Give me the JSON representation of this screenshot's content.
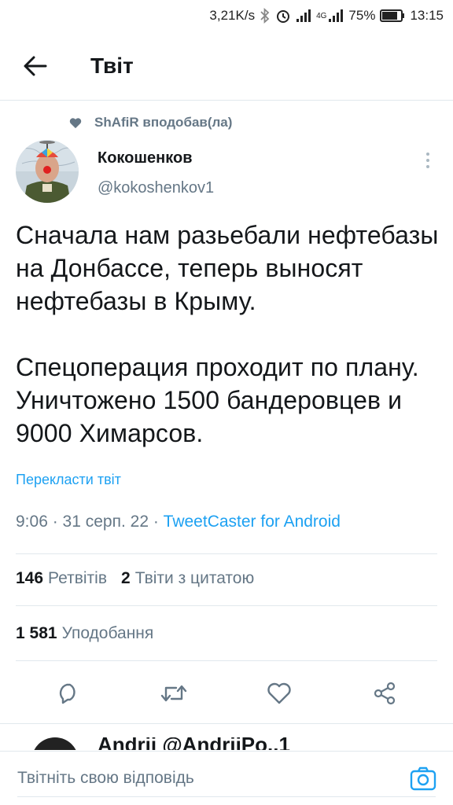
{
  "status_bar": {
    "net_speed": "3,21K/s",
    "network_type": "4G",
    "battery": "75%",
    "time": "13:15",
    "icons": [
      "bluetooth-icon",
      "alarm-icon",
      "signal-icon",
      "signal-4g-icon",
      "battery-icon"
    ]
  },
  "header": {
    "title": "Твіт",
    "back_icon": "arrow-left-icon"
  },
  "social_context": {
    "text": "ShAfiR вподобав(ла)",
    "icon": "heart-filled-icon"
  },
  "tweet": {
    "author_name": "Кокошенков",
    "author_handle": "@kokoshenkov1",
    "text": "Сначала нам разьебали нефтебазы на Донбассе, теперь выносят нефтебазы в Крыму.\n\nСпецоперация проходит по плану. Уничтожено 1500 бандеровцев и 9000 Химарсов.",
    "translate_label": "Перекласти твіт",
    "time": "9:06",
    "date": "31 серп. 22",
    "separator": " · ",
    "source": "TweetCaster for Android"
  },
  "stats": {
    "retweets_count": "146",
    "retweets_label": "Ретвітів",
    "quotes_count": "2",
    "quotes_label": "Твіти з цитатою",
    "likes_count": "1 581",
    "likes_label": "Уподобання"
  },
  "actions": [
    "reply-icon",
    "retweet-icon",
    "like-icon",
    "share-icon"
  ],
  "reply_peek": {
    "text": "Andrii @AndriiPo..1"
  },
  "composer": {
    "placeholder": "Твітніть свою відповідь",
    "camera_icon": "camera-icon"
  },
  "colors": {
    "accent": "#1da1f2",
    "secondary_text": "#657786",
    "primary_text": "#14171a",
    "divider": "#e1e8ed"
  }
}
